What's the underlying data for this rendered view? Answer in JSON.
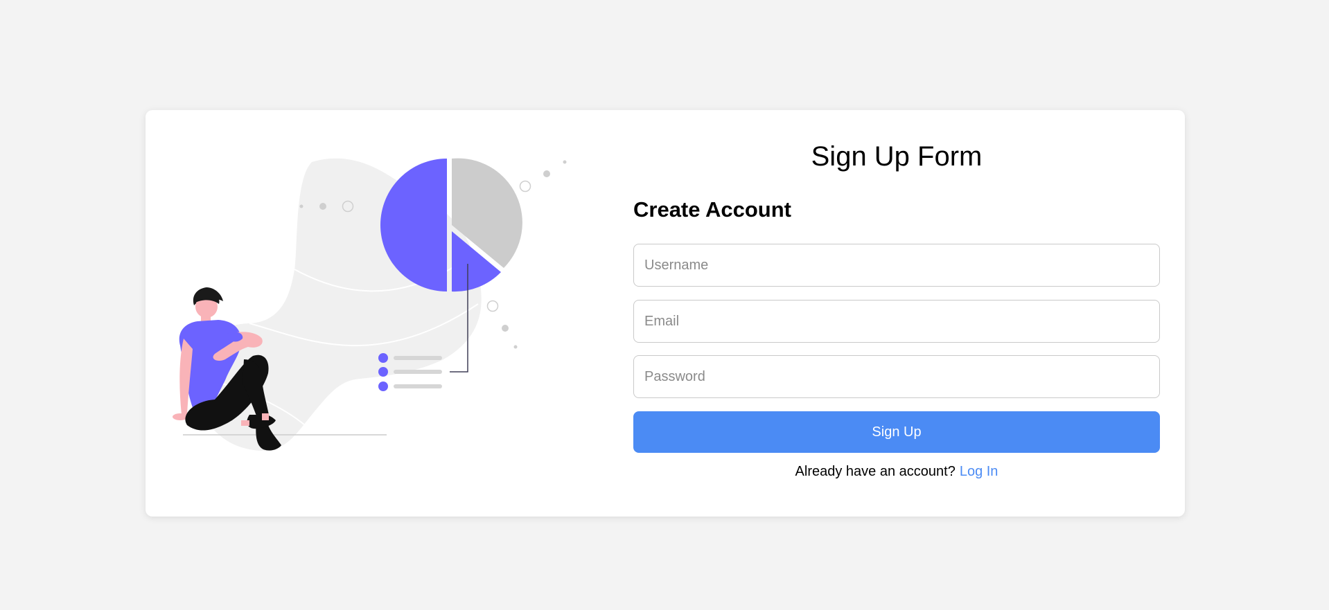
{
  "page": {
    "background": "#f3f3f3"
  },
  "illustration": {
    "name": "person-with-pie-chart-illustration",
    "accent": "#6c63ff",
    "secondary": "#cccccc"
  },
  "form": {
    "title": "Sign Up Form",
    "heading": "Create Account",
    "username_placeholder": "Username",
    "email_placeholder": "Email",
    "password_placeholder": "Password",
    "submit_label": "Sign Up",
    "login_prompt": "Already have an account?",
    "login_link": "Log In",
    "accent": "#4b8bf4"
  }
}
